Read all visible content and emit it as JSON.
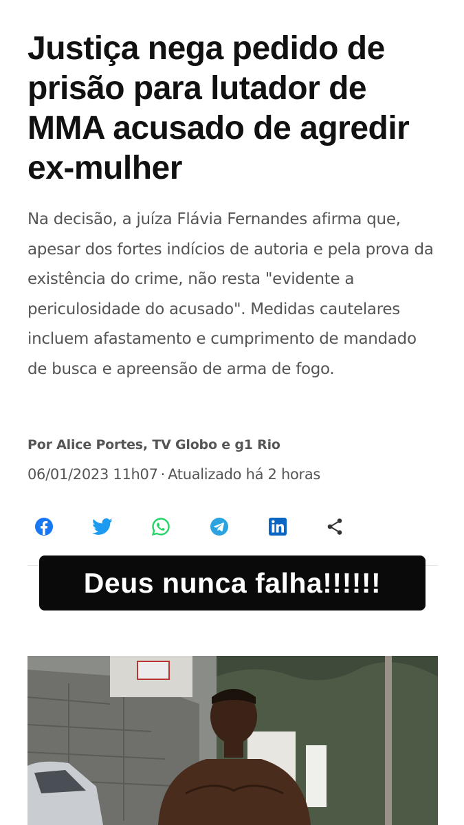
{
  "article": {
    "headline": "Justiça nega pedido de prisão para lutador de MMA acusado de agredir ex-mulher",
    "summary": "Na decisão, a juíza Flávia Fernandes afirma que, apesar dos fortes indícios de autoria e pela prova da existência do crime, não resta \"evidente a periculosidade do acusado\". Medidas cautelares incluem afastamento e cumprimento de mandado de busca e apreensão de arma de fogo.",
    "byline": "Por Alice Portes, TV Globo e g1 Rio",
    "date": "06/01/2023 11h07",
    "separator": "·",
    "updated": "Atualizado há 2 horas"
  },
  "share": {
    "icons": [
      "facebook-icon",
      "twitter-icon",
      "whatsapp-icon",
      "telegram-icon",
      "linkedin-icon",
      "share-icon"
    ],
    "colors": {
      "facebook": "#1877f2",
      "twitter": "#1d9bf0",
      "whatsapp": "#25d366",
      "telegram": "#2aa3df",
      "linkedin": "#0a66c2",
      "share": "#333333"
    }
  },
  "overlay": {
    "text": "Deus nunca falha!!!!!!"
  },
  "photo": {
    "description_icon": "article-photo"
  }
}
